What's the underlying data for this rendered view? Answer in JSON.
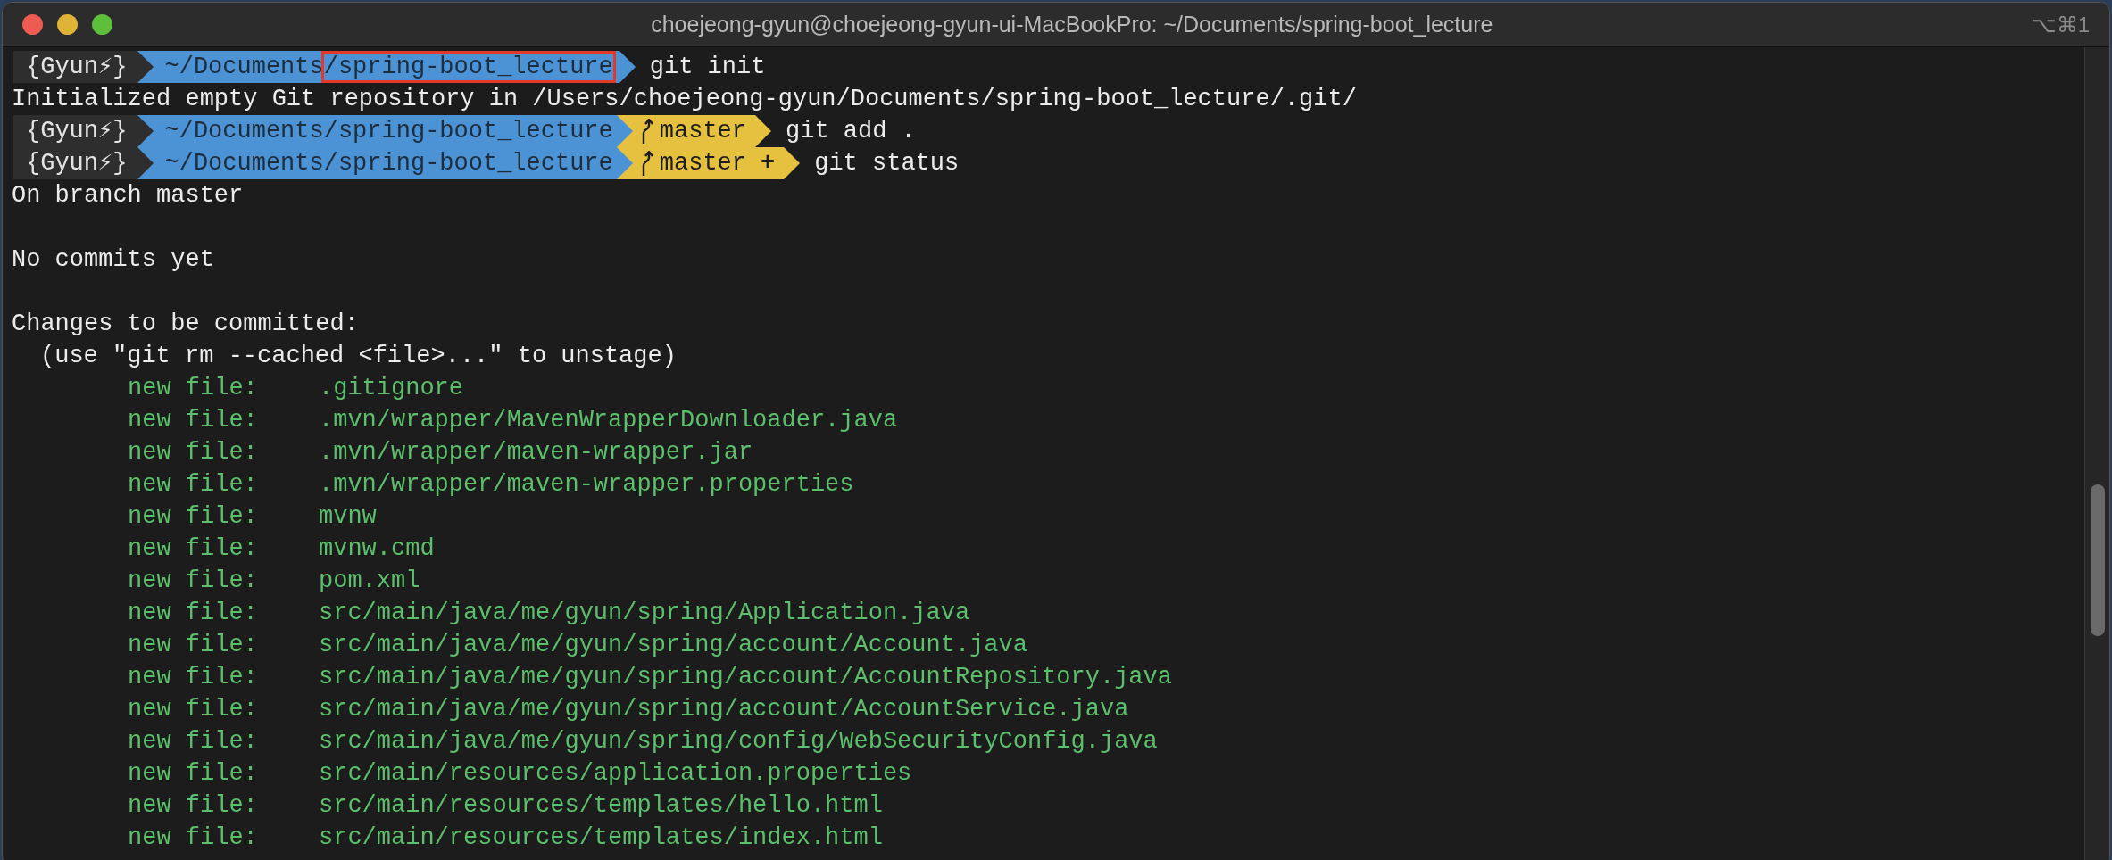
{
  "window": {
    "title": "choejeong-gyun@choejeong-gyun-ui-MacBookPro: ~/Documents/spring-boot_lecture",
    "shortcut": "⌥⌘1"
  },
  "lines": [
    {
      "kind": "prompt",
      "user": "{Gyun⚡}",
      "path_parts": [
        {
          "text": "~/Documents",
          "highlighted": false
        },
        {
          "text": "/spring-boot_lecture",
          "highlighted": true
        }
      ],
      "command": "git init"
    },
    {
      "kind": "output",
      "text": "Initialized empty Git repository in /Users/choejeong-gyun/Documents/spring-boot_lecture/.git/"
    },
    {
      "kind": "prompt",
      "user": "{Gyun⚡}",
      "path_parts": [
        {
          "text": "~/Documents/spring-boot_lecture",
          "highlighted": false
        }
      ],
      "branch": {
        "name": "master"
      },
      "command": "git add ."
    },
    {
      "kind": "prompt",
      "user": "{Gyun⚡}",
      "path_parts": [
        {
          "text": "~/Documents/spring-boot_lecture",
          "highlighted": false
        }
      ],
      "branch": {
        "name": "master",
        "status": "+"
      },
      "command": "git status"
    },
    {
      "kind": "output",
      "text": "On branch master"
    },
    {
      "kind": "blank"
    },
    {
      "kind": "output",
      "text": "No commits yet"
    },
    {
      "kind": "blank"
    },
    {
      "kind": "output",
      "text": "Changes to be committed:"
    },
    {
      "kind": "hint",
      "text": "(use \"git rm --cached <file>...\" to unstage)"
    },
    {
      "kind": "staged",
      "label": "new file:",
      "path": ".gitignore"
    },
    {
      "kind": "staged",
      "label": "new file:",
      "path": ".mvn/wrapper/MavenWrapperDownloader.java"
    },
    {
      "kind": "staged",
      "label": "new file:",
      "path": ".mvn/wrapper/maven-wrapper.jar"
    },
    {
      "kind": "staged",
      "label": "new file:",
      "path": ".mvn/wrapper/maven-wrapper.properties"
    },
    {
      "kind": "staged",
      "label": "new file:",
      "path": "mvnw"
    },
    {
      "kind": "staged",
      "label": "new file:",
      "path": "mvnw.cmd"
    },
    {
      "kind": "staged",
      "label": "new file:",
      "path": "pom.xml"
    },
    {
      "kind": "staged",
      "label": "new file:",
      "path": "src/main/java/me/gyun/spring/Application.java"
    },
    {
      "kind": "staged",
      "label": "new file:",
      "path": "src/main/java/me/gyun/spring/account/Account.java"
    },
    {
      "kind": "staged",
      "label": "new file:",
      "path": "src/main/java/me/gyun/spring/account/AccountRepository.java"
    },
    {
      "kind": "staged",
      "label": "new file:",
      "path": "src/main/java/me/gyun/spring/account/AccountService.java"
    },
    {
      "kind": "staged",
      "label": "new file:",
      "path": "src/main/java/me/gyun/spring/config/WebSecurityConfig.java"
    },
    {
      "kind": "staged",
      "label": "new file:",
      "path": "src/main/resources/application.properties"
    },
    {
      "kind": "staged",
      "label": "new file:",
      "path": "src/main/resources/templates/hello.html"
    },
    {
      "kind": "staged",
      "label": "new file:",
      "path": "src/main/resources/templates/index.html"
    }
  ]
}
